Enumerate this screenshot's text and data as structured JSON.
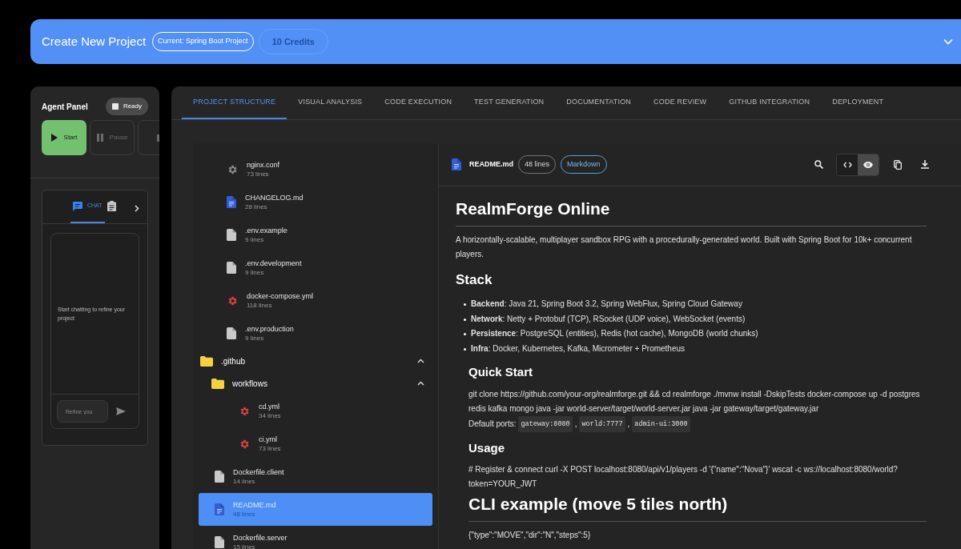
{
  "header": {
    "title": "Create New Project",
    "current_chip": "Current: Spring Boot Project",
    "credits_chip": {
      "text": "10 Credits",
      "disabled": true
    }
  },
  "agent_panel": {
    "title": "Agent Panel",
    "status": "Ready",
    "controls": [
      {
        "kind": "start",
        "label": "Start",
        "disabled": false
      },
      {
        "kind": "pause",
        "label": "Pause",
        "disabled": true
      },
      {
        "kind": "stop",
        "disabled": true
      }
    ],
    "chat": {
      "tabs": [
        {
          "kind": "chat",
          "label": "CHAT",
          "selected": true
        },
        {
          "kind": "tasks",
          "selected": false
        }
      ],
      "empty_message": "Start chatting to refine your project",
      "input_placeholder": "Refine you"
    }
  },
  "tabs": [
    {
      "label": "PROJECT STRUCTURE",
      "selected": true
    },
    {
      "label": "VISUAL ANALYSIS",
      "selected": false
    },
    {
      "label": "CODE EXECUTION",
      "selected": false
    },
    {
      "label": "TEST GENERATION",
      "selected": false
    },
    {
      "label": "DOCUMENTATION",
      "selected": false
    },
    {
      "label": "CODE REVIEW",
      "selected": false
    },
    {
      "label": "GITHUB INTEGRATION",
      "selected": false
    },
    {
      "label": "DEPLOYMENT",
      "selected": false
    }
  ],
  "tree": [
    {
      "kind": "continued",
      "children": [
        {
          "kind": "config",
          "name": "nginx.conf",
          "lines": "73 lines",
          "selected": false
        },
        {
          "kind": "markdown",
          "name": "CHANGELOG.md",
          "lines": "28 lines",
          "selected": false
        },
        {
          "kind": "file",
          "name": ".env.example",
          "lines": "9 lines",
          "selected": false
        },
        {
          "kind": "file",
          "name": ".env.development",
          "lines": "9 lines",
          "selected": false
        },
        {
          "kind": "yaml",
          "name": "docker-compose.yml",
          "lines": "118 lines",
          "selected": false
        },
        {
          "kind": "file",
          "name": ".env.production",
          "lines": "9 lines",
          "selected": false
        }
      ]
    },
    {
      "kind": "folder",
      "name": ".github",
      "expanded": true,
      "children": [
        {
          "kind": "folder",
          "name": "workflows",
          "expanded": true,
          "children": [
            {
              "kind": "yaml",
              "name": "cd.yml",
              "lines": "34 lines",
              "selected": false
            },
            {
              "kind": "yaml",
              "name": "ci.yml",
              "lines": "73 lines",
              "selected": false
            }
          ]
        }
      ]
    },
    {
      "kind": "file",
      "name": "Dockerfile.client",
      "lines": "14 lines",
      "selected": false
    },
    {
      "kind": "markdown",
      "name": "README.md",
      "lines": "48 lines",
      "selected": true
    },
    {
      "kind": "file",
      "name": "Dockerfile.server",
      "lines": "15 lines",
      "selected": false
    }
  ],
  "viewer": {
    "file_name": "README.md",
    "lines_chip": "48 lines",
    "format_chip": "Markdown",
    "view_modes": [
      {
        "kind": "code",
        "selected": false
      },
      {
        "kind": "preview",
        "selected": true
      }
    ],
    "content": [
      {
        "kind": "h1",
        "text": "RealmForge Online"
      },
      {
        "kind": "p",
        "text": "A horizontally-scalable, multiplayer sandbox RPG with a procedurally-generated world. Built with Spring Boot for 10k+ concurrent players."
      },
      {
        "kind": "h2",
        "text": "Stack"
      },
      {
        "kind": "ul",
        "items": [
          "**Backend**: Java 21, Spring Boot 3.2, Spring WebFlux, Spring Cloud Gateway",
          "**Network**: Netty + Protobuf (TCP), RSocket (UDP voice), WebSocket (events)",
          "**Persistence**: PostgreSQL (entities), Redis (hot cache), MongoDB (world chunks)",
          "**Infra**: Docker, Kubernetes, Kafka, Micrometer + Prometheus"
        ]
      },
      {
        "kind": "section",
        "blocks": [
          {
            "kind": "h3",
            "text": "Quick Start"
          },
          {
            "kind": "p",
            "text": "git clone https://github.com/your-org/realmforge.git && cd realmforge ./mvnw install -DskipTests docker-compose up -d postgres redis kafka mongo java -jar world-server/target/world-server.jar java -jar gateway/target/gateway.jar"
          },
          {
            "kind": "inline",
            "parts": [
              {
                "kind": "text",
                "text": "Default ports:"
              },
              {
                "kind": "code",
                "text": "gateway:8080"
              },
              {
                "kind": "text",
                "text": ","
              },
              {
                "kind": "code",
                "text": "world:7777"
              },
              {
                "kind": "text",
                "text": ","
              },
              {
                "kind": "code",
                "text": "admin-ui:3000"
              }
            ]
          },
          {
            "kind": "h3",
            "text": "Usage"
          },
          {
            "kind": "p",
            "text": "# Register & connect curl -X POST localhost:8080/api/v1/players -d '{\"name\":\"Nova\"}' wscat -c ws://localhost:8080/world?token=YOUR_JWT"
          },
          {
            "kind": "h1",
            "text": "CLI example (move 5 tiles north)"
          },
          {
            "kind": "p",
            "text": "{\"type\":\"MOVE\",\"dir\":\"N\",\"steps\":5}"
          }
        ]
      }
    ]
  }
}
